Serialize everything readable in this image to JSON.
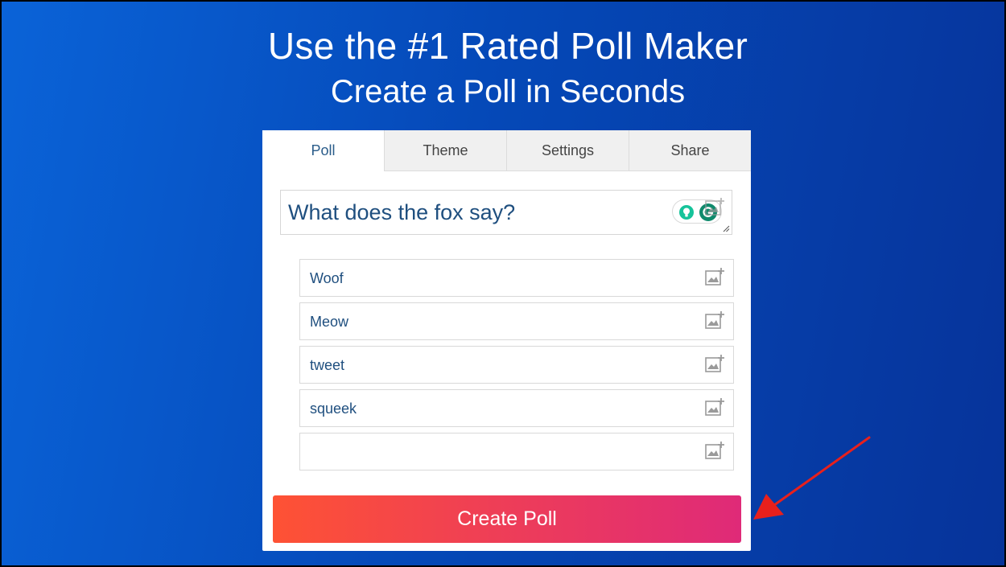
{
  "hero": {
    "title": "Use the #1 Rated Poll Maker",
    "subtitle": "Create a Poll in Seconds"
  },
  "tabs": [
    {
      "label": "Poll",
      "active": true
    },
    {
      "label": "Theme",
      "active": false
    },
    {
      "label": "Settings",
      "active": false
    },
    {
      "label": "Share",
      "active": false
    }
  ],
  "question": {
    "value": "What does the fox say?",
    "icons": [
      "lightbulb-icon",
      "grammarly-icon",
      "add-image-icon",
      "resize-handle-icon"
    ]
  },
  "options": [
    {
      "value": "Woof"
    },
    {
      "value": "Meow"
    },
    {
      "value": "tweet"
    },
    {
      "value": "squeek"
    },
    {
      "value": ""
    }
  ],
  "create_button": {
    "label": "Create Poll"
  },
  "colors": {
    "background_start": "#0a63d8",
    "background_end": "#06339a",
    "button_start": "#fe5234",
    "button_end": "#df2a78",
    "text_blue": "#1f4f7f",
    "arrow_red": "#e8201c"
  }
}
